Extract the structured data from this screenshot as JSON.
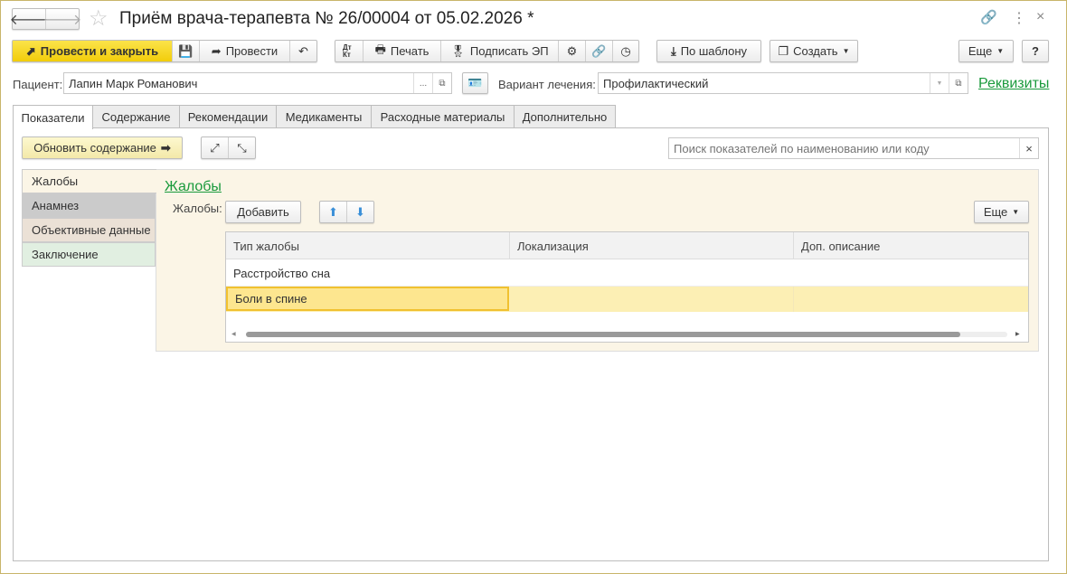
{
  "title": "Приём врача-терапевта № 26/00004 от 05.02.2026 *",
  "toolbar": {
    "post_close": "Провести и закрыть",
    "post": "Провести",
    "print": "Печать",
    "sign": "Подписать ЭП",
    "by_template": "По шаблону",
    "create": "Создать",
    "more": "Еще",
    "help": "?",
    "dtkt": "Дт Кт"
  },
  "patient": {
    "label": "Пациент:",
    "value": "Лапин Марк Романович",
    "select": "..."
  },
  "treatment": {
    "label": "Вариант лечения:",
    "value": "Профилактический"
  },
  "requisites_link": "Реквизиты",
  "tabs": [
    "Показатели",
    "Содержание",
    "Рекомендации",
    "Медикаменты",
    "Расходные материалы",
    "Дополнительно"
  ],
  "update_button": "Обновить содержание",
  "search": {
    "placeholder": "Поиск показателей по наименованию или коду",
    "clear": "×"
  },
  "sections": [
    "Жалобы",
    "Анамнез",
    "Объективные данные",
    "Заключение"
  ],
  "complaints": {
    "heading": "Жалобы",
    "label": "Жалобы:",
    "add": "Добавить",
    "more": "Еще",
    "columns": [
      "Тип жалобы",
      "Локализация",
      "Доп. описание"
    ],
    "rows": [
      [
        "Расстройство сна",
        "",
        ""
      ],
      [
        "Боли в спине",
        "",
        ""
      ]
    ]
  },
  "colors": {
    "accent": "#f5d327",
    "link": "#1a9a3c",
    "selected_row": "#fcefb4"
  }
}
